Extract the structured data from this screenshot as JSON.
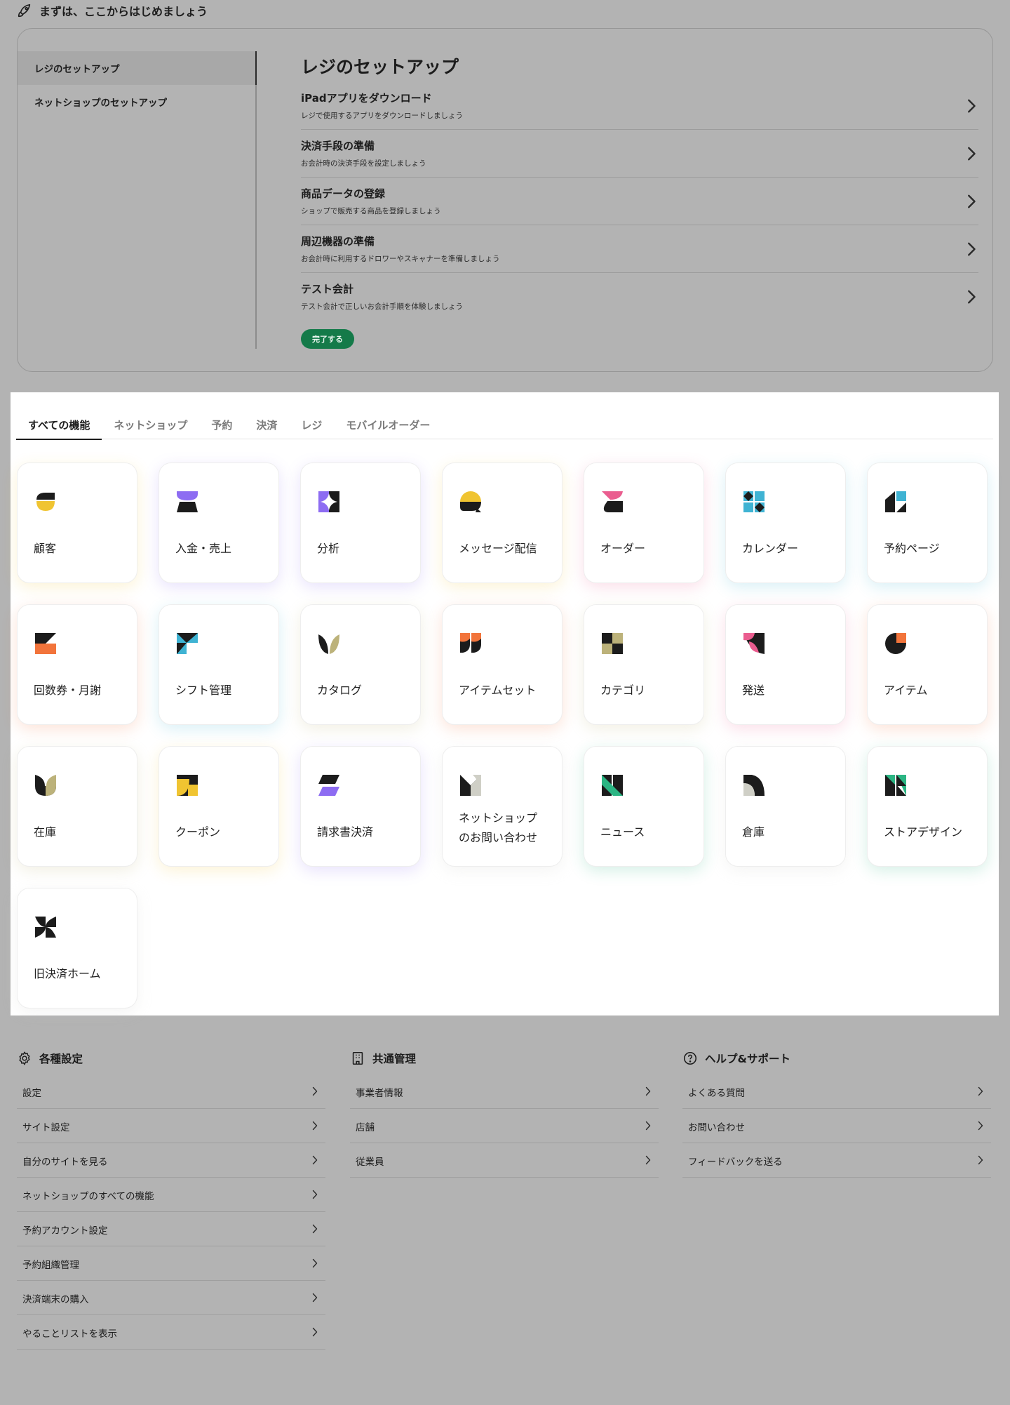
{
  "setup": {
    "header_title": "まずは、ここからはじめましょう",
    "nav": [
      {
        "label": "レジのセットアップ",
        "active": true
      },
      {
        "label": "ネットショップのセットアップ",
        "active": false
      }
    ],
    "section_title": "レジのセットアップ",
    "steps": [
      {
        "title": "iPadアプリをダウンロード",
        "desc": "レジで使用するアプリをダウンロードしましょう"
      },
      {
        "title": "決済手段の準備",
        "desc": "お会計時の決済手段を設定しましょう"
      },
      {
        "title": "商品データの登録",
        "desc": "ショップで販売する商品を登録しましょう"
      },
      {
        "title": "周辺機器の準備",
        "desc": "お会計時に利用するドロワーやスキャナーを準備しましょう"
      },
      {
        "title": "テスト会計",
        "desc": "テスト会計で正しいお会計手順を体験しましょう"
      }
    ],
    "complete_label": "完了する",
    "complete_color": "#147a49"
  },
  "features": {
    "tabs": [
      {
        "label": "すべての機能",
        "active": true
      },
      {
        "label": "ネットショップ",
        "active": false
      },
      {
        "label": "予約",
        "active": false
      },
      {
        "label": "決済",
        "active": false
      },
      {
        "label": "レジ",
        "active": false
      },
      {
        "label": "モバイルオーダー",
        "active": false
      }
    ],
    "cards": [
      {
        "label": "顧客",
        "icon": "customer-icon"
      },
      {
        "label": "入金・売上",
        "icon": "payout-icon"
      },
      {
        "label": "分析",
        "icon": "analytics-icon"
      },
      {
        "label": "メッセージ配信",
        "icon": "message-icon"
      },
      {
        "label": "オーダー",
        "icon": "order-icon"
      },
      {
        "label": "カレンダー",
        "icon": "calendar-icon"
      },
      {
        "label": "予約ページ",
        "icon": "booking-page-icon"
      },
      {
        "label": "回数券・月謝",
        "icon": "ticket-icon"
      },
      {
        "label": "シフト管理",
        "icon": "shift-icon"
      },
      {
        "label": "カタログ",
        "icon": "catalog-icon"
      },
      {
        "label": "アイテムセット",
        "icon": "item-set-icon"
      },
      {
        "label": "カテゴリ",
        "icon": "category-icon"
      },
      {
        "label": "発送",
        "icon": "shipping-icon"
      },
      {
        "label": "アイテム",
        "icon": "item-icon"
      },
      {
        "label": "在庫",
        "icon": "inventory-icon"
      },
      {
        "label": "クーポン",
        "icon": "coupon-icon"
      },
      {
        "label": "請求書決済",
        "icon": "invoice-icon"
      },
      {
        "label": "ネットショップ\nのお問い合わせ",
        "icon": "shop-inquiry-icon"
      },
      {
        "label": "ニュース",
        "icon": "news-icon"
      },
      {
        "label": "倉庫",
        "icon": "warehouse-icon"
      },
      {
        "label": "ストアデザイン",
        "icon": "store-design-icon"
      },
      {
        "label": "旧決済ホーム",
        "icon": "legacy-payment-icon"
      }
    ]
  },
  "footer": {
    "settings": {
      "title": "各種設定",
      "items": [
        "設定",
        "サイト設定",
        "自分のサイトを見る",
        "ネットショップのすべての機能",
        "予約アカウント設定",
        "予約組織管理",
        "決済端末の購入",
        "やることリストを表示"
      ]
    },
    "common": {
      "title": "共通管理",
      "items": [
        "事業者情報",
        "店舗",
        "従業員"
      ]
    },
    "help": {
      "title": "ヘルプ&サポート",
      "items": [
        "よくある質問",
        "お問い合わせ",
        "フィードバックを送る"
      ]
    }
  },
  "colors": {
    "yellow": "#f0c431",
    "purple": "#8d6cf2",
    "pink": "#ea5d8f",
    "cyan": "#3fb3d3",
    "orange": "#f2743b",
    "khaki": "#bcb27a",
    "green": "#2bb583",
    "gray": "#cfcfc6",
    "black": "#1c1c1c"
  }
}
